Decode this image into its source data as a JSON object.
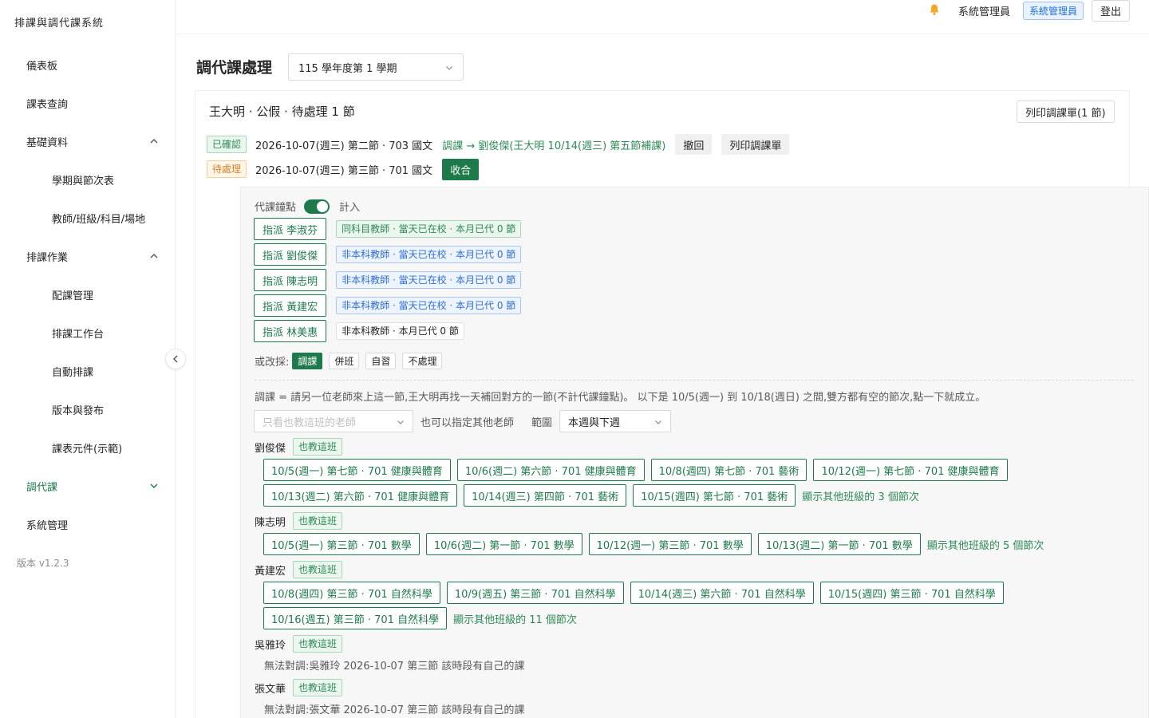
{
  "app": {
    "title": "排課與調代課系統",
    "version": "版本 v1.2.3"
  },
  "sidebar": {
    "items": [
      {
        "label": "儀表板"
      },
      {
        "label": "課表查詢"
      },
      {
        "label": "基礎資料"
      },
      {
        "label": "學期與節次表"
      },
      {
        "label": "教師/班級/科目/場地"
      },
      {
        "label": "排課作業"
      },
      {
        "label": "配課管理"
      },
      {
        "label": "排課工作台"
      },
      {
        "label": "自動排課"
      },
      {
        "label": "版本與發布"
      },
      {
        "label": "課表元件(示範)"
      },
      {
        "label": "調代課"
      },
      {
        "label": "系統管理"
      }
    ]
  },
  "header": {
    "user": "系統管理員",
    "role": "系統管理員",
    "logout": "登出"
  },
  "page": {
    "title": "調代課處理",
    "semester": "115 學年度第 1 學期"
  },
  "case": {
    "title": "王大明 · 公假 · 待處理 1 節",
    "print_all": "列印調課單(1 節)",
    "confirmed": {
      "status": "已確認",
      "text": "2026-10-07(週三) 第二節 · 703 國文",
      "result": "調課 → 劉俊傑(王大明 10/14(週三) 第五節補課)",
      "revoke": "撤回",
      "print": "列印調課單"
    },
    "pending": {
      "status": "待處理",
      "text": "2026-10-07(週三) 第三節 · 701 國文",
      "collapse": "收合"
    }
  },
  "panel": {
    "toggle_label": "代課鐘點",
    "toggle_value": "計入",
    "assign": [
      {
        "btn": "指派 李淑芬",
        "info": "同科目教師 · 當天已在校 · 本月已代 0 節"
      },
      {
        "btn": "指派 劉俊傑",
        "info": "非本科教師 · 當天已在校 · 本月已代 0 節"
      },
      {
        "btn": "指派 陳志明",
        "info": "非本科教師 · 當天已在校 · 本月已代 0 節"
      },
      {
        "btn": "指派 黃建宏",
        "info": "非本科教師 · 當天已在校 · 本月已代 0 節"
      },
      {
        "btn": "指派 林美惠",
        "info": "非本科教師 · 本月已代 0 節"
      }
    ],
    "alt_label": "或改採:",
    "alt_options": [
      "調課",
      "併班",
      "自習",
      "不處理"
    ],
    "explain": "調課 = 請另一位老師來上這一節,王大明再找一天補回對方的一節(不計代課鐘點)。 以下是 10/5(週一) 到 10/18(週日) 之間,雙方都有空的節次,點一下就成立。",
    "filter_placeholder": "只看也教這班的老師",
    "filter_hint": "也可以指定其他老師",
    "range_label": "範圍",
    "range_value": "本週與下週",
    "also_teaches": "也教這班",
    "teachers": {
      "t1": {
        "name": "劉俊傑",
        "row1": [
          "10/5(週一) 第七節 · 701 健康與體育",
          "10/6(週二) 第六節 · 701 健康與體育",
          "10/8(週四) 第七節 · 701 藝術",
          "10/12(週一) 第七節 · 701 健康與體育"
        ],
        "row2": [
          "10/13(週二) 第六節 · 701 健康與體育",
          "10/14(週三) 第四節 · 701 藝術",
          "10/15(週四) 第七節 · 701 藝術"
        ],
        "more": "顯示其他班級的 3 個節次"
      },
      "t2": {
        "name": "陳志明",
        "row1": [
          "10/5(週一) 第三節 · 701 數學",
          "10/6(週二) 第一節 · 701 數學",
          "10/12(週一) 第三節 · 701 數學",
          "10/13(週二) 第一節 · 701 數學"
        ],
        "more": "顯示其他班級的 5 個節次"
      },
      "t3": {
        "name": "黃建宏",
        "row1": [
          "10/8(週四) 第三節 · 701 自然科學",
          "10/9(週五) 第三節 · 701 自然科學",
          "10/14(週三) 第六節 · 701 自然科學",
          "10/15(週四) 第三節 · 701 自然科學"
        ],
        "row2": [
          "10/16(週五) 第三節 · 701 自然科學"
        ],
        "more": "顯示其他班級的 11 個節次"
      },
      "t4": {
        "name": "吳雅玲",
        "note": "無法對調:吳雅玲 2026-10-07 第三節 該時段有自己的課"
      },
      "t5": {
        "name": "張文華",
        "note": "無法對調:張文華 2026-10-07 第三節 該時段有自己的課"
      }
    }
  },
  "icons": {
    "bell": "bell-icon",
    "chevron": "chevron-icon",
    "collapse": "chevron-left-icon"
  },
  "colors": {
    "accent": "#1f7a4b",
    "bell": "#f5a623"
  }
}
